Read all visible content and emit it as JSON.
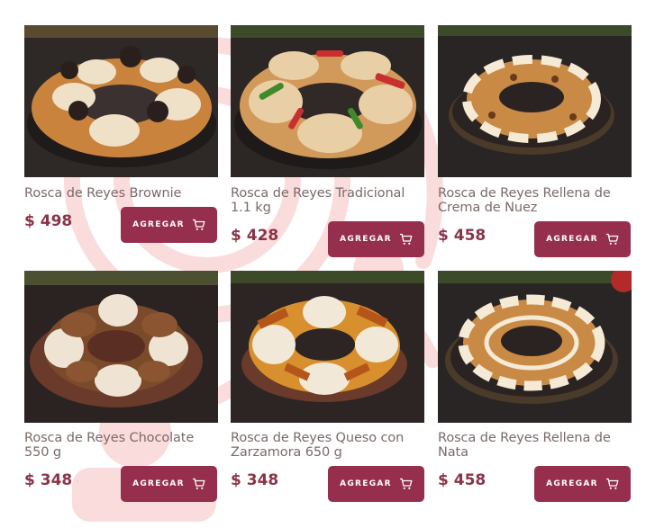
{
  "colors": {
    "accent": "#962f4e",
    "price": "#8a3448",
    "name": "#7a6a68",
    "decor": "#fadcdc"
  },
  "products": [
    {
      "name": "Rosca de Reyes Brownie",
      "price": "$ 498",
      "button": "AGREGAR",
      "icon": "cart-icon"
    },
    {
      "name": "Rosca de Reyes Tradicional 1.1 kg",
      "price": "$ 428",
      "button": "AGREGAR",
      "icon": "cart-icon"
    },
    {
      "name": "Rosca de Reyes Rellena de Crema de Nuez",
      "price": "$ 458",
      "button": "AGREGAR",
      "icon": "cart-icon"
    },
    {
      "name": "Rosca de Reyes Chocolate 550 g",
      "price": "$ 348",
      "button": "AGREGAR",
      "icon": "cart-icon"
    },
    {
      "name": "Rosca de Reyes Queso con Zarzamora 650 g",
      "price": "$ 348",
      "button": "AGREGAR",
      "icon": "cart-icon"
    },
    {
      "name": "Rosca de Reyes Rellena de Nata",
      "price": "$ 458",
      "button": "AGREGAR",
      "icon": "cart-icon"
    }
  ]
}
